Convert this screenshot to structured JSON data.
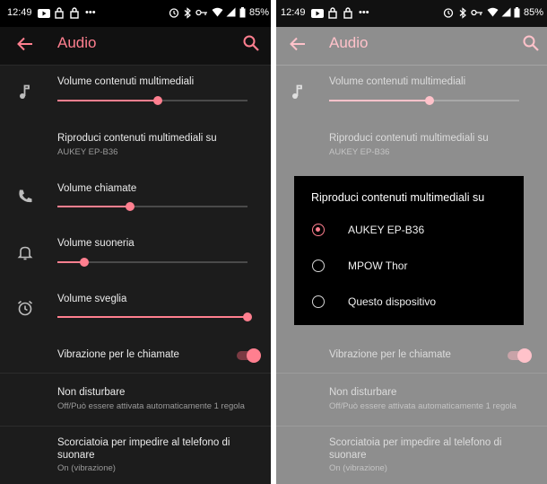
{
  "status": {
    "time": "12:49",
    "signal_dots": "•••",
    "battery": "85%"
  },
  "appbar": {
    "title": "Audio"
  },
  "settings": {
    "media_volume": {
      "label": "Volume contenuti multimediali",
      "level": 0.53
    },
    "play_media_on": {
      "label": "Riproduci contenuti multimediali su",
      "value": "AUKEY EP-B36"
    },
    "call_volume": {
      "label": "Volume chiamate",
      "level": 0.38
    },
    "ring_volume": {
      "label": "Volume suoneria",
      "level": 0.14
    },
    "alarm_volume": {
      "label": "Volume sveglia",
      "level": 1.0
    },
    "vibrate_calls": {
      "label": "Vibrazione per le chiamate",
      "on": true
    },
    "do_not_disturb": {
      "label": "Non disturbare",
      "summary": "Off/Può essere attivata automaticamente 1 regola"
    },
    "shortcut": {
      "label_line1": "Scorciatoia per impedire al telefono di",
      "label_line2": "suonare",
      "summary": "On (vibrazione)"
    }
  },
  "dialog": {
    "title": "Riproduci contenuti multimediali su",
    "options": [
      {
        "label": "AUKEY EP-B36",
        "selected": true
      },
      {
        "label": "MPOW Thor",
        "selected": false
      },
      {
        "label": "Questo dispositivo",
        "selected": false
      }
    ]
  },
  "colors": {
    "accent": "#ff7f8f",
    "background": "#1c1c1c",
    "dim_background": "#8e8e8e"
  },
  "icons": [
    "back-arrow-icon",
    "search-icon",
    "music-note-icon",
    "phone-icon",
    "bell-icon",
    "alarm-clock-icon"
  ]
}
